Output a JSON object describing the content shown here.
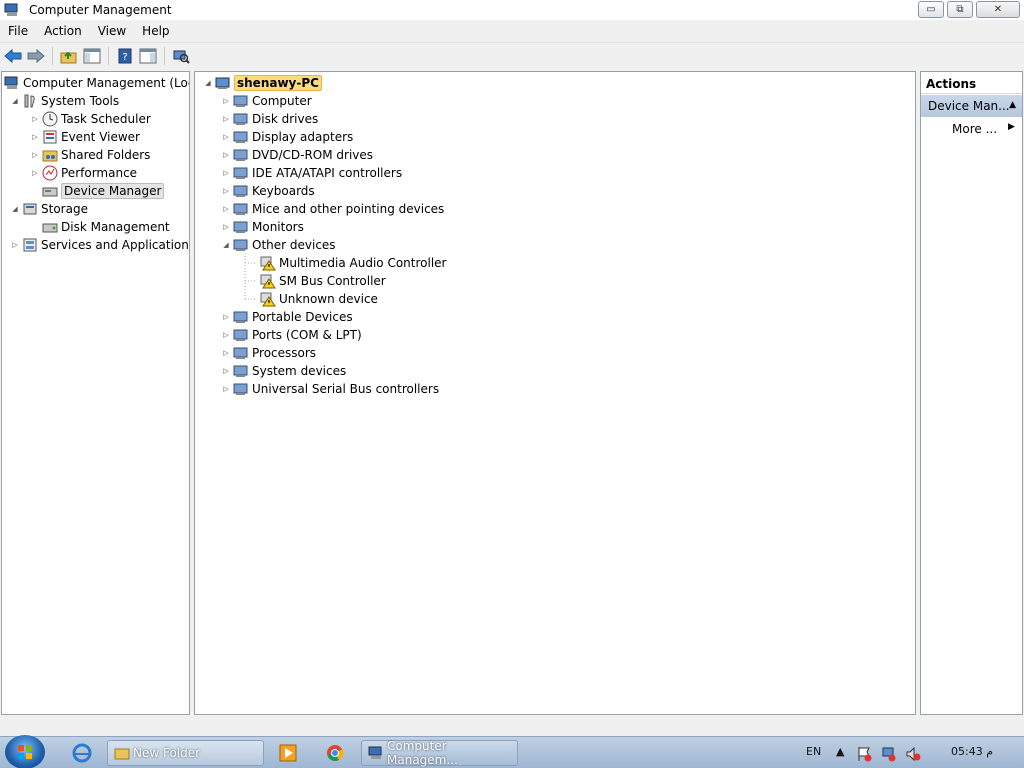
{
  "window": {
    "title": "Computer Management",
    "min_glyph": "▭",
    "max_glyph": "⧉",
    "close_glyph": "✕"
  },
  "menubar": [
    "File",
    "Action",
    "View",
    "Help"
  ],
  "toolbar": [
    "back-arrow-icon",
    "forward-arrow-icon",
    "up-folder-icon",
    "show-hide-console-tree-icon",
    "help-icon",
    "show-hide-action-pane-icon",
    "scan-hardware-icon"
  ],
  "left_tree": {
    "root": "Computer Management (Local",
    "system_tools": "System Tools",
    "task_scheduler": "Task Scheduler",
    "event_viewer": "Event Viewer",
    "shared_folders": "Shared Folders",
    "performance": "Performance",
    "device_manager": "Device Manager",
    "storage": "Storage",
    "disk_management": "Disk Management",
    "services_apps": "Services and Applications"
  },
  "device_tree": {
    "root": "shenawy-PC",
    "categories": [
      {
        "label": "Computer",
        "icon": "computer-icon"
      },
      {
        "label": "Disk drives",
        "icon": "disk-drive-icon"
      },
      {
        "label": "Display adapters",
        "icon": "display-adapter-icon"
      },
      {
        "label": "DVD/CD-ROM drives",
        "icon": "dvd-drive-icon"
      },
      {
        "label": "IDE ATA/ATAPI controllers",
        "icon": "ide-controller-icon"
      },
      {
        "label": "Keyboards",
        "icon": "keyboard-icon"
      },
      {
        "label": "Mice and other pointing devices",
        "icon": "mouse-icon"
      },
      {
        "label": "Monitors",
        "icon": "monitor-icon"
      },
      {
        "label": "Other devices",
        "icon": "unknown-device-icon"
      }
    ],
    "other_devices": [
      {
        "label": "Multimedia Audio Controller",
        "icon": "warning-icon"
      },
      {
        "label": "SM Bus Controller",
        "icon": "warning-icon"
      },
      {
        "label": "Unknown device",
        "icon": "warning-icon"
      }
    ],
    "categories_after": [
      {
        "label": "Portable Devices",
        "icon": "portable-device-icon"
      },
      {
        "label": "Ports (COM & LPT)",
        "icon": "port-icon"
      },
      {
        "label": "Processors",
        "icon": "processor-icon"
      },
      {
        "label": "System devices",
        "icon": "system-device-icon"
      },
      {
        "label": "Universal Serial Bus controllers",
        "icon": "usb-icon"
      }
    ]
  },
  "actions": {
    "header": "Actions",
    "section": "Device Man...",
    "more": "More ..."
  },
  "taskbar": {
    "new_folder": "New Folder",
    "computer_management": "Computer Managem...",
    "lang": "EN",
    "time": "05:43 م"
  }
}
